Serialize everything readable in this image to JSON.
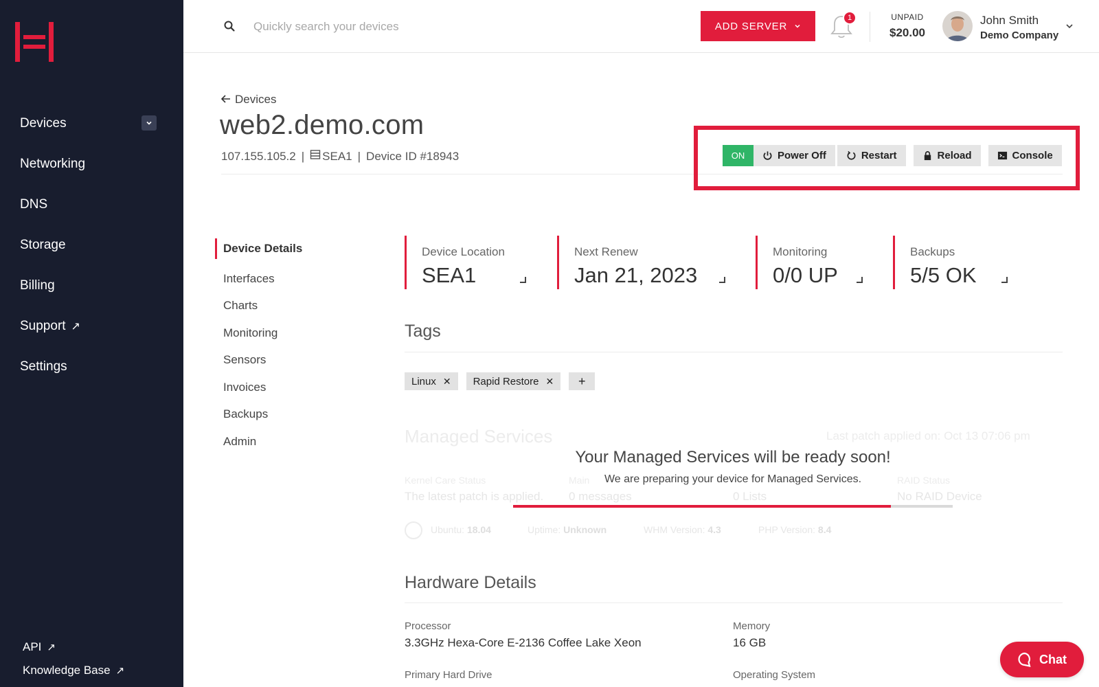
{
  "sidebar": {
    "items": [
      {
        "label": "Devices"
      },
      {
        "label": "Networking"
      },
      {
        "label": "DNS"
      },
      {
        "label": "Storage"
      },
      {
        "label": "Billing"
      },
      {
        "label": "Support"
      },
      {
        "label": "Settings"
      }
    ],
    "bottom": [
      {
        "label": "API"
      },
      {
        "label": "Knowledge Base"
      }
    ]
  },
  "header": {
    "search_placeholder": "Quickly search your devices",
    "add_server_label": "ADD SERVER",
    "notifications_count": "1",
    "unpaid_label": "UNPAID",
    "unpaid_amount": "$20.00",
    "user_name": "John Smith",
    "user_company": "Demo Company"
  },
  "device": {
    "back_label": "Devices",
    "title": "web2.demo.com",
    "ip": "107.155.105.2",
    "location": "SEA1",
    "device_id": "Device ID #18943"
  },
  "power": {
    "status": "ON",
    "power_off_label": "Power Off",
    "restart_label": "Restart",
    "reload_label": "Reload",
    "console_label": "Console"
  },
  "subnav": [
    {
      "label": "Device Details"
    },
    {
      "label": "Interfaces"
    },
    {
      "label": "Charts"
    },
    {
      "label": "Monitoring"
    },
    {
      "label": "Sensors"
    },
    {
      "label": "Invoices"
    },
    {
      "label": "Backups"
    },
    {
      "label": "Admin"
    }
  ],
  "stats": [
    {
      "label": "Device Location",
      "value": "SEA1"
    },
    {
      "label": "Next Renew",
      "value": "Jan 21, 2023"
    },
    {
      "label": "Monitoring",
      "value": "0/0 UP"
    },
    {
      "label": "Backups",
      "value": "5/5 OK"
    }
  ],
  "tags": {
    "title": "Tags",
    "items": [
      {
        "label": "Linux"
      },
      {
        "label": "Rapid Restore"
      }
    ],
    "add_label": "+"
  },
  "managed": {
    "title": "Managed Services",
    "last_patch": "Last patch applied on: Oct 13 07:06 pm",
    "columns": [
      {
        "label": "Kernel Care Status",
        "value": "The latest patch is applied."
      },
      {
        "label": "Main",
        "value": "0 messages"
      },
      {
        "label": "",
        "value": "0 Lists"
      },
      {
        "label": "RAID Status",
        "value": "No RAID Device"
      }
    ],
    "os_items": [
      {
        "label": "Ubuntu:",
        "value": "18.04"
      },
      {
        "label": "Uptime:",
        "value": "Unknown"
      },
      {
        "label": "WHM Version:",
        "value": "4.3"
      },
      {
        "label": "PHP Version:",
        "value": "8.4"
      }
    ],
    "ready_title": "Your Managed Services will be ready soon!",
    "ready_subtitle": "We are preparing your device for Managed Services.",
    "progress": 0.86
  },
  "hardware": {
    "title": "Hardware Details",
    "processor_label": "Processor",
    "processor_value": "3.3GHz Hexa-Core E-2136 Coffee Lake Xeon",
    "memory_label": "Memory",
    "memory_value": "16 GB",
    "drive_label": "Primary Hard Drive",
    "os_label": "Operating System"
  },
  "chat": {
    "label": "Chat"
  },
  "colors": {
    "accent": "#e11d3c",
    "sidebar": "#181d2e",
    "on": "#2fb567"
  }
}
